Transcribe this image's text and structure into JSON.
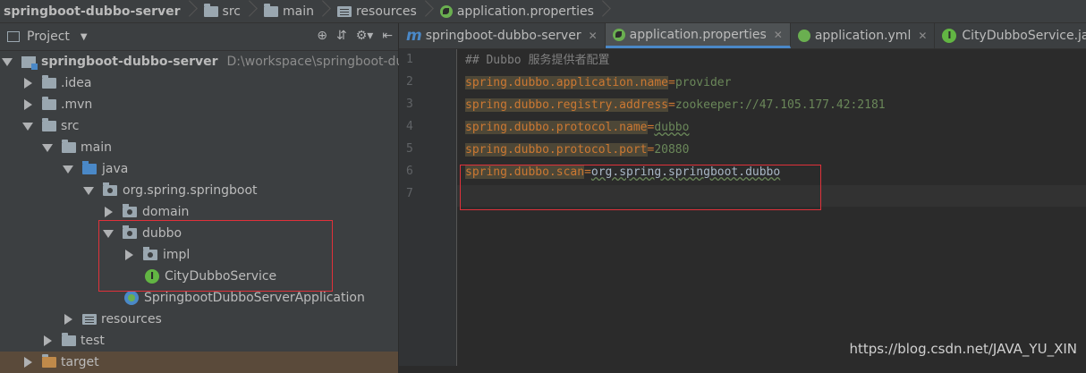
{
  "breadcrumb": {
    "items": [
      "springboot-dubbo-server",
      "src",
      "main",
      "resources",
      "application.properties"
    ]
  },
  "project_panel": {
    "title": "Project",
    "tools": [
      "⊕",
      "⇵",
      "⚙▾",
      "⇤"
    ],
    "tree": [
      {
        "label": "springboot-dubbo-server",
        "path": "D:\\workspace\\springboot-dubbo"
      },
      {
        "label": ".idea"
      },
      {
        "label": ".mvn"
      },
      {
        "label": "src"
      },
      {
        "label": "main"
      },
      {
        "label": "java"
      },
      {
        "label": "org.spring.springboot"
      },
      {
        "label": "domain"
      },
      {
        "label": "dubbo"
      },
      {
        "label": "impl"
      },
      {
        "label": "CityDubboService",
        "badge": "I"
      },
      {
        "label": "SpringbootDubboServerApplication"
      },
      {
        "label": "resources"
      },
      {
        "label": "test"
      },
      {
        "label": "target"
      }
    ]
  },
  "editor": {
    "tabs": [
      {
        "label": "springboot-dubbo-server",
        "icon": "m"
      },
      {
        "label": "application.properties"
      },
      {
        "label": "application.yml"
      },
      {
        "label": "CityDubboService.java",
        "badge": "I"
      }
    ],
    "line_numbers": [
      "1",
      "2",
      "3",
      "4",
      "5",
      "6",
      "7"
    ],
    "lines": [
      {
        "comment": "## Dubbo 服务提供者配置"
      },
      {
        "key": "spring.dubbo.application.name",
        "eq": "=",
        "value": "provider"
      },
      {
        "key": "spring.dubbo.registry.address",
        "eq": "=",
        "value": "zookeeper://47.105.177.42:2181"
      },
      {
        "key": "spring.dubbo.protocol.name",
        "eq": "=",
        "value": "dubbo"
      },
      {
        "key": "spring.dubbo.protocol.port",
        "eq": "=",
        "value": "20880"
      },
      {
        "key": "spring.dubbo.scan",
        "eq": "=",
        "value": "org.spring.springboot.dubbo"
      }
    ]
  },
  "watermark": "https://blog.csdn.net/JAVA_YU_XIN",
  "colors": {
    "highlight_box": "#e0313a",
    "accent": "#4a88c7"
  }
}
